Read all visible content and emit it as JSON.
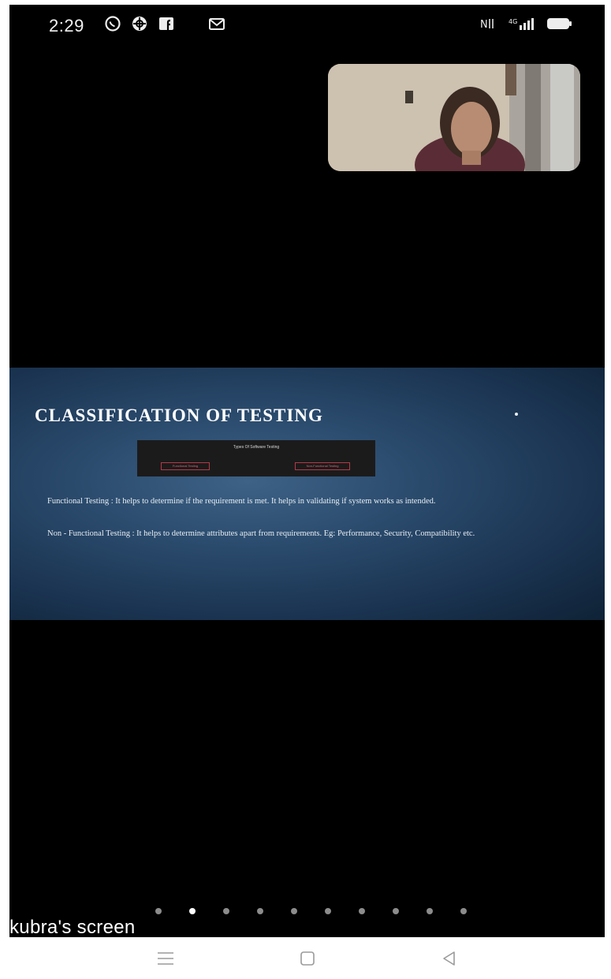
{
  "status_bar": {
    "time": "2:29",
    "left_icons": [
      "whatsapp-icon",
      "globe-icon",
      "facebook-icon",
      "gmail-icon"
    ],
    "right_icons": [
      "volte-icon",
      "signal-icon",
      "battery-icon"
    ]
  },
  "video_tile": {
    "participant": "camera-feed"
  },
  "slide": {
    "title": "CLASSIFICATION OF TESTING",
    "diagram": {
      "heading": "Types Of Software Testing",
      "left_box": "Functional Testing",
      "right_box": "Non-Functional Testing"
    },
    "paragraph1": "Functional Testing : It helps to determine if the requirement is met. It helps in validating if system works as intended.",
    "paragraph2": "Non - Functional Testing : It helps to determine attributes apart from requirements. Eg: Performance, Security, Compatibility etc."
  },
  "pagination": {
    "total": 10,
    "active_index": 1
  },
  "screen_label": "kubra's screen",
  "nav_bar": {
    "menu": "menu-icon",
    "home": "home-icon",
    "back": "back-icon"
  },
  "colors": {
    "background": "#000000",
    "slide_gradient_center": "#3d6286",
    "slide_gradient_edge": "#0f2236",
    "accent_red": "#b23a48"
  }
}
